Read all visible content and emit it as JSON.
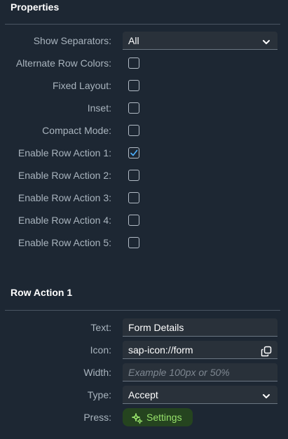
{
  "properties": {
    "title": "Properties",
    "show_separators": {
      "label": "Show Separators:",
      "value": "All"
    },
    "checkboxes": [
      {
        "label": "Alternate Row Colors:",
        "checked": false
      },
      {
        "label": "Fixed Layout:",
        "checked": false
      },
      {
        "label": "Inset:",
        "checked": false
      },
      {
        "label": "Compact Mode:",
        "checked": false
      },
      {
        "label": "Enable Row Action 1:",
        "checked": true
      },
      {
        "label": "Enable Row Action 2:",
        "checked": false
      },
      {
        "label": "Enable Row Action 3:",
        "checked": false
      },
      {
        "label": "Enable Row Action 4:",
        "checked": false
      },
      {
        "label": "Enable Row Action 5:",
        "checked": false
      }
    ]
  },
  "row_action": {
    "title": "Row Action 1",
    "text": {
      "label": "Text:",
      "value": "Form Details"
    },
    "icon": {
      "label": "Icon:",
      "value": "sap-icon://form",
      "icon_name": "value-help-icon"
    },
    "width": {
      "label": "Width:",
      "value": "",
      "placeholder": "Example 100px or 50%"
    },
    "type": {
      "label": "Type:",
      "value": "Accept"
    },
    "press": {
      "label": "Press:",
      "button_label": "Settings",
      "icon_name": "gears-icon"
    }
  },
  "colors": {
    "background": "#1d2733",
    "field_bg": "#29313a",
    "label": "#a9b4be",
    "accent": "#4db1ff",
    "settings_text": "#97e26b",
    "settings_bg": "#25441f"
  }
}
